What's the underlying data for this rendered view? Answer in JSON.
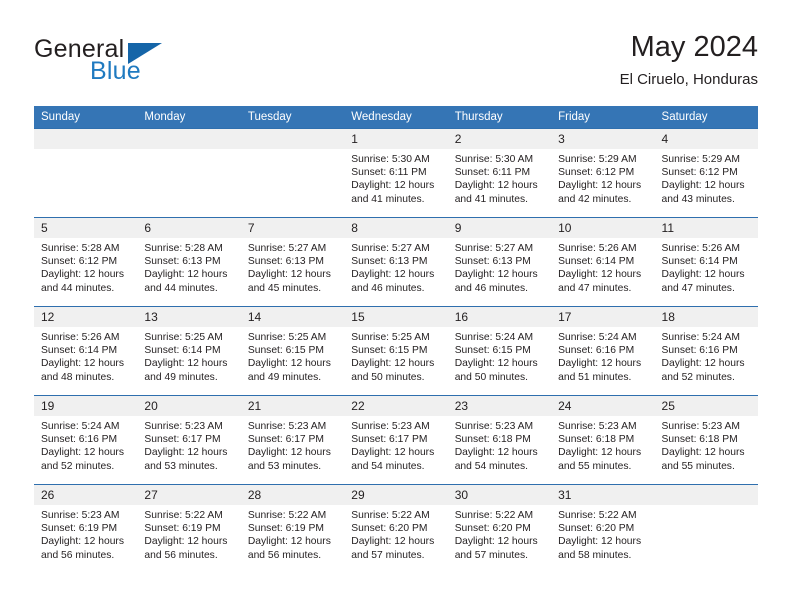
{
  "brand": {
    "word_general": "General",
    "word_blue": "Blue",
    "logo_icon": "triangle-logo-icon",
    "accent_color": "#1f7ac0",
    "header_color": "#3575b5"
  },
  "header": {
    "title": "May 2024",
    "subtitle": "El Ciruelo, Honduras"
  },
  "weekday_headers": [
    "Sunday",
    "Monday",
    "Tuesday",
    "Wednesday",
    "Thursday",
    "Friday",
    "Saturday"
  ],
  "weeks": [
    [
      {
        "day": "",
        "blank": true,
        "sunrise": "",
        "sunset": "",
        "daylight_line1": "",
        "daylight_line2": ""
      },
      {
        "day": "",
        "blank": true,
        "sunrise": "",
        "sunset": "",
        "daylight_line1": "",
        "daylight_line2": ""
      },
      {
        "day": "",
        "blank": true,
        "sunrise": "",
        "sunset": "",
        "daylight_line1": "",
        "daylight_line2": ""
      },
      {
        "day": "1",
        "sunrise": "Sunrise: 5:30 AM",
        "sunset": "Sunset: 6:11 PM",
        "daylight_line1": "Daylight: 12 hours",
        "daylight_line2": "and 41 minutes."
      },
      {
        "day": "2",
        "sunrise": "Sunrise: 5:30 AM",
        "sunset": "Sunset: 6:11 PM",
        "daylight_line1": "Daylight: 12 hours",
        "daylight_line2": "and 41 minutes."
      },
      {
        "day": "3",
        "sunrise": "Sunrise: 5:29 AM",
        "sunset": "Sunset: 6:12 PM",
        "daylight_line1": "Daylight: 12 hours",
        "daylight_line2": "and 42 minutes."
      },
      {
        "day": "4",
        "sunrise": "Sunrise: 5:29 AM",
        "sunset": "Sunset: 6:12 PM",
        "daylight_line1": "Daylight: 12 hours",
        "daylight_line2": "and 43 minutes."
      }
    ],
    [
      {
        "day": "5",
        "sunrise": "Sunrise: 5:28 AM",
        "sunset": "Sunset: 6:12 PM",
        "daylight_line1": "Daylight: 12 hours",
        "daylight_line2": "and 44 minutes."
      },
      {
        "day": "6",
        "sunrise": "Sunrise: 5:28 AM",
        "sunset": "Sunset: 6:13 PM",
        "daylight_line1": "Daylight: 12 hours",
        "daylight_line2": "and 44 minutes."
      },
      {
        "day": "7",
        "sunrise": "Sunrise: 5:27 AM",
        "sunset": "Sunset: 6:13 PM",
        "daylight_line1": "Daylight: 12 hours",
        "daylight_line2": "and 45 minutes."
      },
      {
        "day": "8",
        "sunrise": "Sunrise: 5:27 AM",
        "sunset": "Sunset: 6:13 PM",
        "daylight_line1": "Daylight: 12 hours",
        "daylight_line2": "and 46 minutes."
      },
      {
        "day": "9",
        "sunrise": "Sunrise: 5:27 AM",
        "sunset": "Sunset: 6:13 PM",
        "daylight_line1": "Daylight: 12 hours",
        "daylight_line2": "and 46 minutes."
      },
      {
        "day": "10",
        "sunrise": "Sunrise: 5:26 AM",
        "sunset": "Sunset: 6:14 PM",
        "daylight_line1": "Daylight: 12 hours",
        "daylight_line2": "and 47 minutes."
      },
      {
        "day": "11",
        "sunrise": "Sunrise: 5:26 AM",
        "sunset": "Sunset: 6:14 PM",
        "daylight_line1": "Daylight: 12 hours",
        "daylight_line2": "and 47 minutes."
      }
    ],
    [
      {
        "day": "12",
        "sunrise": "Sunrise: 5:26 AM",
        "sunset": "Sunset: 6:14 PM",
        "daylight_line1": "Daylight: 12 hours",
        "daylight_line2": "and 48 minutes."
      },
      {
        "day": "13",
        "sunrise": "Sunrise: 5:25 AM",
        "sunset": "Sunset: 6:14 PM",
        "daylight_line1": "Daylight: 12 hours",
        "daylight_line2": "and 49 minutes."
      },
      {
        "day": "14",
        "sunrise": "Sunrise: 5:25 AM",
        "sunset": "Sunset: 6:15 PM",
        "daylight_line1": "Daylight: 12 hours",
        "daylight_line2": "and 49 minutes."
      },
      {
        "day": "15",
        "sunrise": "Sunrise: 5:25 AM",
        "sunset": "Sunset: 6:15 PM",
        "daylight_line1": "Daylight: 12 hours",
        "daylight_line2": "and 50 minutes."
      },
      {
        "day": "16",
        "sunrise": "Sunrise: 5:24 AM",
        "sunset": "Sunset: 6:15 PM",
        "daylight_line1": "Daylight: 12 hours",
        "daylight_line2": "and 50 minutes."
      },
      {
        "day": "17",
        "sunrise": "Sunrise: 5:24 AM",
        "sunset": "Sunset: 6:16 PM",
        "daylight_line1": "Daylight: 12 hours",
        "daylight_line2": "and 51 minutes."
      },
      {
        "day": "18",
        "sunrise": "Sunrise: 5:24 AM",
        "sunset": "Sunset: 6:16 PM",
        "daylight_line1": "Daylight: 12 hours",
        "daylight_line2": "and 52 minutes."
      }
    ],
    [
      {
        "day": "19",
        "sunrise": "Sunrise: 5:24 AM",
        "sunset": "Sunset: 6:16 PM",
        "daylight_line1": "Daylight: 12 hours",
        "daylight_line2": "and 52 minutes."
      },
      {
        "day": "20",
        "sunrise": "Sunrise: 5:23 AM",
        "sunset": "Sunset: 6:17 PM",
        "daylight_line1": "Daylight: 12 hours",
        "daylight_line2": "and 53 minutes."
      },
      {
        "day": "21",
        "sunrise": "Sunrise: 5:23 AM",
        "sunset": "Sunset: 6:17 PM",
        "daylight_line1": "Daylight: 12 hours",
        "daylight_line2": "and 53 minutes."
      },
      {
        "day": "22",
        "sunrise": "Sunrise: 5:23 AM",
        "sunset": "Sunset: 6:17 PM",
        "daylight_line1": "Daylight: 12 hours",
        "daylight_line2": "and 54 minutes."
      },
      {
        "day": "23",
        "sunrise": "Sunrise: 5:23 AM",
        "sunset": "Sunset: 6:18 PM",
        "daylight_line1": "Daylight: 12 hours",
        "daylight_line2": "and 54 minutes."
      },
      {
        "day": "24",
        "sunrise": "Sunrise: 5:23 AM",
        "sunset": "Sunset: 6:18 PM",
        "daylight_line1": "Daylight: 12 hours",
        "daylight_line2": "and 55 minutes."
      },
      {
        "day": "25",
        "sunrise": "Sunrise: 5:23 AM",
        "sunset": "Sunset: 6:18 PM",
        "daylight_line1": "Daylight: 12 hours",
        "daylight_line2": "and 55 minutes."
      }
    ],
    [
      {
        "day": "26",
        "sunrise": "Sunrise: 5:23 AM",
        "sunset": "Sunset: 6:19 PM",
        "daylight_line1": "Daylight: 12 hours",
        "daylight_line2": "and 56 minutes."
      },
      {
        "day": "27",
        "sunrise": "Sunrise: 5:22 AM",
        "sunset": "Sunset: 6:19 PM",
        "daylight_line1": "Daylight: 12 hours",
        "daylight_line2": "and 56 minutes."
      },
      {
        "day": "28",
        "sunrise": "Sunrise: 5:22 AM",
        "sunset": "Sunset: 6:19 PM",
        "daylight_line1": "Daylight: 12 hours",
        "daylight_line2": "and 56 minutes."
      },
      {
        "day": "29",
        "sunrise": "Sunrise: 5:22 AM",
        "sunset": "Sunset: 6:20 PM",
        "daylight_line1": "Daylight: 12 hours",
        "daylight_line2": "and 57 minutes."
      },
      {
        "day": "30",
        "sunrise": "Sunrise: 5:22 AM",
        "sunset": "Sunset: 6:20 PM",
        "daylight_line1": "Daylight: 12 hours",
        "daylight_line2": "and 57 minutes."
      },
      {
        "day": "31",
        "sunrise": "Sunrise: 5:22 AM",
        "sunset": "Sunset: 6:20 PM",
        "daylight_line1": "Daylight: 12 hours",
        "daylight_line2": "and 58 minutes."
      },
      {
        "day": "",
        "blank": true,
        "sunrise": "",
        "sunset": "",
        "daylight_line1": "",
        "daylight_line2": ""
      }
    ]
  ]
}
